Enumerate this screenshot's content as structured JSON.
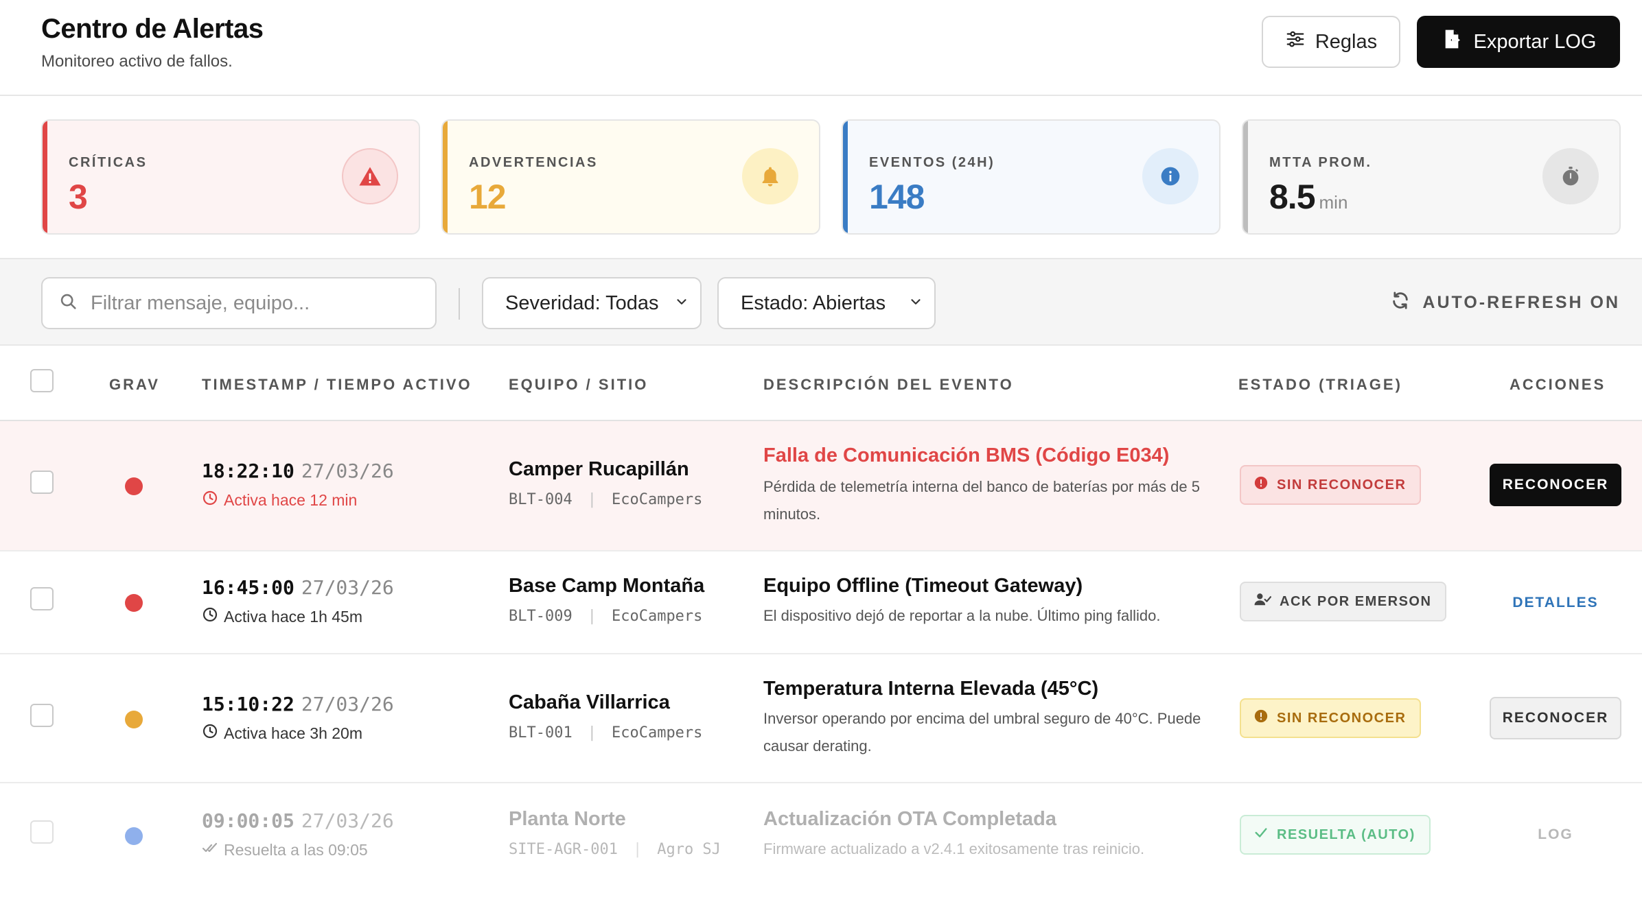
{
  "header": {
    "title": "Centro de Alertas",
    "subtitle": "Monitoreo activo de fallos.",
    "rules_label": "Reglas",
    "export_label": "Exportar LOG"
  },
  "stats": [
    {
      "label": "CRÍTICAS",
      "value": "3",
      "unit": "",
      "color": "#e04646",
      "bg": "#fdf3f3",
      "icon": "warning-icon"
    },
    {
      "label": "ADVERTENCIAS",
      "value": "12",
      "unit": "",
      "color": "#e8a93a",
      "bg": "#fffcf1",
      "icon": "bell-icon"
    },
    {
      "label": "EVENTOS (24H)",
      "value": "148",
      "unit": "",
      "color": "#3a7cc4",
      "bg": "#f6f9fd",
      "icon": "info-icon"
    },
    {
      "label": "MTTA PROM.",
      "value": "8.5",
      "unit": "min",
      "color": "#1b1b1b",
      "bg": "#f7f7f7",
      "icon": "stopwatch-icon"
    }
  ],
  "filters": {
    "search_placeholder": "Filtrar mensaje, equipo...",
    "severity_label": "Severidad: Todas",
    "status_label": "Estado: Abiertas",
    "autorefresh_label": "AUTO-REFRESH ON"
  },
  "table": {
    "columns": {
      "severity": "GRAV",
      "timestamp": "TIMESTAMP / TIEMPO ACTIVO",
      "equipment": "EQUIPO / SITIO",
      "description": "DESCRIPCIÓN DEL EVENTO",
      "status": "ESTADO (TRIAGE)",
      "actions": "ACCIONES"
    },
    "rows": [
      {
        "time": "18:22:10",
        "date": "27/03/26",
        "since": "Activa hace 12 min",
        "equipment": "Camper Rucapillán",
        "code": "BLT-004",
        "site": "EcoCampers",
        "title": "Falla de Comunicación BMS (Código E034)",
        "detail": "Pérdida de telemetría interna del banco de baterías por más de 5 minutos.",
        "status": "SIN RECONOCER",
        "action": "RECONOCER",
        "severity_color": "#e04646"
      },
      {
        "time": "16:45:00",
        "date": "27/03/26",
        "since": "Activa hace 1h 45m",
        "equipment": "Base Camp Montaña",
        "code": "BLT-009",
        "site": "EcoCampers",
        "title": "Equipo Offline (Timeout Gateway)",
        "detail": "El dispositivo dejó de reportar a la nube. Último ping fallido.",
        "status": "ACK POR EMERSON",
        "action": "DETALLES",
        "severity_color": "#e04646"
      },
      {
        "time": "15:10:22",
        "date": "27/03/26",
        "since": "Activa hace 3h 20m",
        "equipment": "Cabaña Villarrica",
        "code": "BLT-001",
        "site": "EcoCampers",
        "title": "Temperatura Interna Elevada (45°C)",
        "detail": "Inversor operando por encima del umbral seguro de 40°C. Puede causar derating.",
        "status": "SIN RECONOCER",
        "action": "RECONOCER",
        "severity_color": "#e8a93a"
      },
      {
        "time": "09:00:05",
        "date": "27/03/26",
        "since": "Resuelta a las 09:05",
        "equipment": "Planta Norte",
        "code": "SITE-AGR-001",
        "site": "Agro SJ",
        "title": "Actualización OTA Completada",
        "detail": "Firmware actualizado a v2.4.1 exitosamente tras reinicio.",
        "status": "RESUELTA (AUTO)",
        "action": "LOG",
        "severity_color": "#8fb0ec"
      }
    ]
  }
}
